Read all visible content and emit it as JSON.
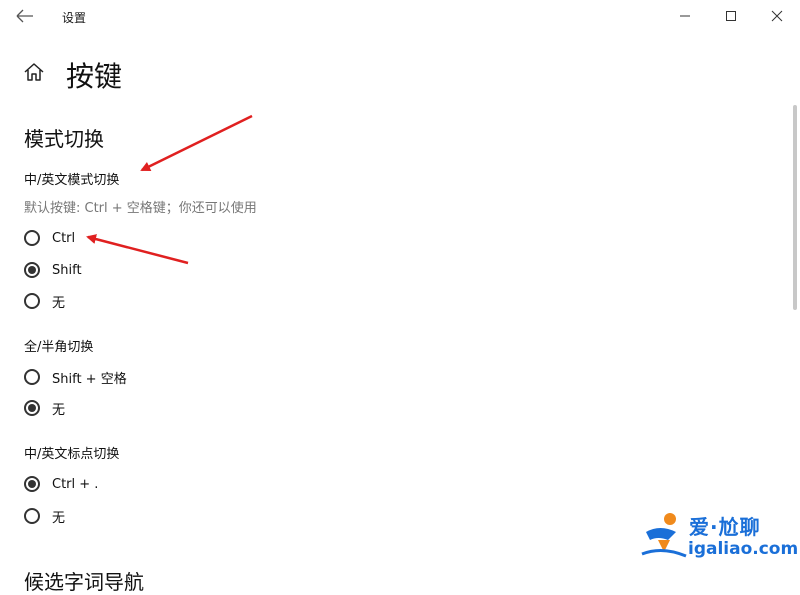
{
  "window": {
    "title": "设置"
  },
  "page": {
    "title": "按键"
  },
  "section": {
    "header": "模式切换"
  },
  "groups": [
    {
      "label": "中/英文模式切换",
      "hint": "默认按键: Ctrl + 空格键；你还可以使用",
      "options": [
        {
          "label": "Ctrl",
          "checked": false
        },
        {
          "label": "Shift",
          "checked": true
        },
        {
          "label": "无",
          "checked": false
        }
      ]
    },
    {
      "label": "全/半角切换",
      "options": [
        {
          "label": "Shift + 空格",
          "checked": false
        },
        {
          "label": "无",
          "checked": true
        }
      ]
    },
    {
      "label": "中/英文标点切换",
      "options": [
        {
          "label": "Ctrl + .",
          "checked": true
        },
        {
          "label": "无",
          "checked": false
        }
      ]
    }
  ],
  "next_section": {
    "header": "候选字词导航"
  },
  "watermark": {
    "line1": "爱·尬聊",
    "line2": "igaliao.com"
  },
  "colors": {
    "annotation_arrow": "#e02020",
    "watermark": "#1a6fd8",
    "text": "#111111",
    "hint": "#777777"
  }
}
